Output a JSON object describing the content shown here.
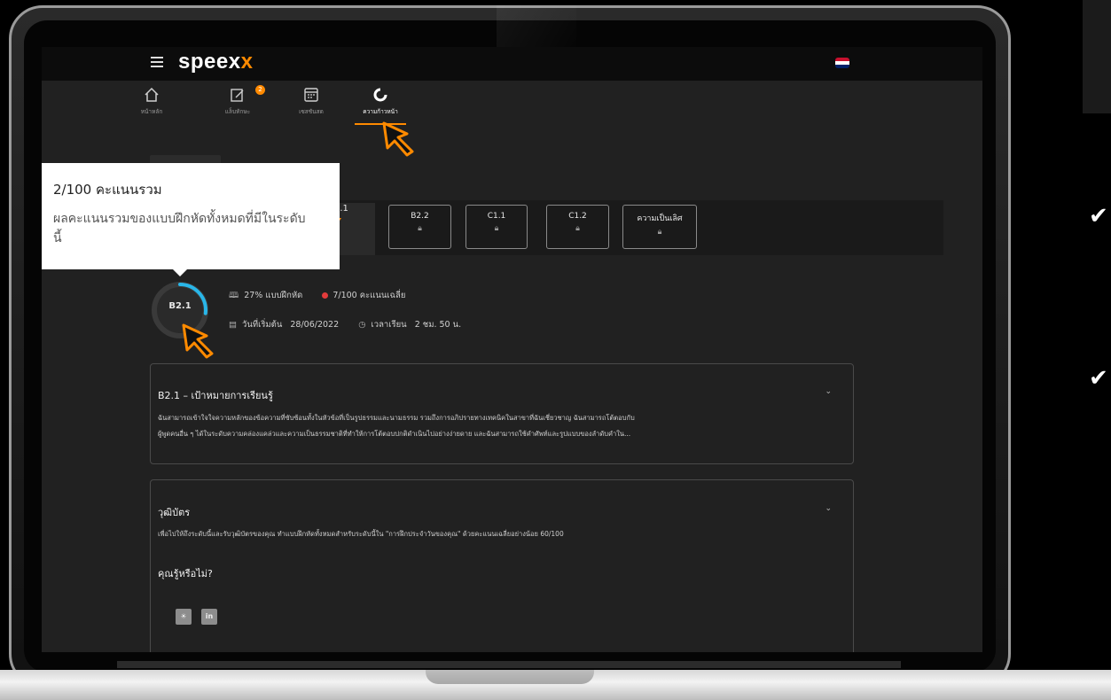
{
  "app": {
    "brand_main": "speex",
    "brand_accent": "x",
    "language_flag": "uk-flag"
  },
  "nav": {
    "items": [
      {
        "label": "หน้าหลัก",
        "icon": "home-icon"
      },
      {
        "label": "แล็บทักษะ",
        "icon": "skills-lab-icon",
        "badge": "2"
      },
      {
        "label": "เซสชันสด",
        "icon": "live-session-icon"
      },
      {
        "label": "ความก้าวหน้า",
        "icon": "progress-icon",
        "active": true
      }
    ]
  },
  "tooltip": {
    "title": "2/100 คะแนนรวม",
    "description": "ผลคะแนนรวมของแบบฝึกหัดทั้งหมดที่มีในระดับนี้"
  },
  "levels": {
    "active_label": "2.1",
    "tabs": [
      {
        "label": "B2.2",
        "locked": true
      },
      {
        "label": "C1.1",
        "locked": true
      },
      {
        "label": "C1.2",
        "locked": true
      },
      {
        "label": "ความเป็นเลิศ",
        "locked": true
      }
    ]
  },
  "progress": {
    "level": "B2.1",
    "ring_fraction": 0.27,
    "exercises": "27% แบบฝึกหัด",
    "average_score": "7/100 คะแนนเฉลี่ย",
    "start_date_label": "วันที่เริ่มต้น",
    "start_date": "28/06/2022",
    "study_time_label": "เวลาเรียน",
    "study_time": "2 ชม. 50 น."
  },
  "goals_card": {
    "title": "B2.1 – เป้าหมายการเรียนรู้",
    "line1": "ฉันสามารถเข้าใจใจความหลักของข้อความที่ซับซ้อนทั้งในหัวข้อที่เป็นรูปธรรมและนามธรรม รวมถึงการอภิปรายทางเทคนิคในสาขาที่ฉันเชี่ยวชาญ ฉันสามารถโต้ตอบกับ",
    "line2": "ผู้พูดคนอื่น ๆ ได้ในระดับความคล่องแคล่วและความเป็นธรรมชาติที่ทำให้การโต้ตอบปกติดำเนินไปอย่างง่ายดาย และฉันสามารถใช้คำศัพท์และรูปแบบของลำดับคำใน..."
  },
  "certificate_card": {
    "title": "วุฒิบัตร",
    "text": "เพื่อไปให้ถึงระดับนี้และรับวุฒิบัตรของคุณ ทำแบบฝึกหัดทั้งหมดสำหรับระดับนี้ใน \"การฝึกประจำวันของคุณ\" ด้วยคะแนนเฉลี่ยอย่างน้อย 60/100",
    "did_you_know": "คุณรู้หรือไม่?",
    "social_linkedin": "in"
  },
  "colors": {
    "accent": "#ff8a00",
    "ring": "#29b6e8",
    "dot": "#e23b3b"
  }
}
